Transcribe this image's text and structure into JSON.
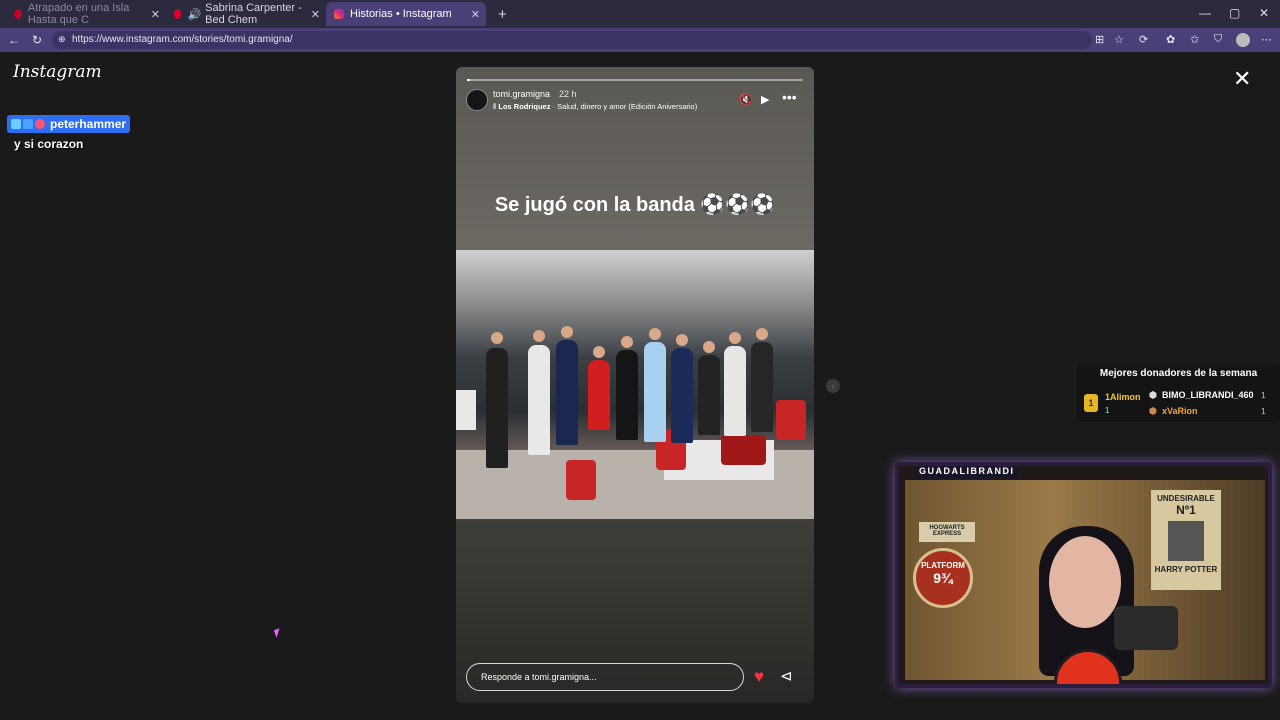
{
  "browser": {
    "tabs": [
      {
        "label": "Atrapado en una Isla Hasta que C",
        "active": false
      },
      {
        "label": "Sabrina Carpenter - Bed Chem",
        "active": false
      },
      {
        "label": "Historias • Instagram",
        "active": true
      }
    ],
    "new_tab": "+",
    "url": "https://www.instagram.com/stories/tomi.gramigna/",
    "window_controls": {
      "minimize": "—",
      "maximize": "▢",
      "close": "✕"
    }
  },
  "instagram": {
    "logo": "Instagram",
    "close": "✕"
  },
  "chat": {
    "username": "peterhammer",
    "message": "y si corazon"
  },
  "story": {
    "username": "tomi.gramigna",
    "time": "22 h",
    "song_artist": "Los Rodriquez",
    "song_title": " · Salud, dinero y amor (Edición Aniversario)",
    "caption": "Se jugó con la banda ⚽⚽⚽",
    "reply_placeholder": "Responde a tomi.gramigna...",
    "progress": 0.01
  },
  "donors": {
    "title": "Mejores donadores de la semana",
    "entries": [
      {
        "rank": "1",
        "name": "1Alimon",
        "count": "1"
      },
      {
        "rank": "2",
        "name": "BIMO_LIBRANDI_460",
        "count": "1"
      },
      {
        "rank": "3",
        "name": "xVaRion",
        "count": "1"
      }
    ]
  },
  "webcam": {
    "label": "GUADALIBRANDI",
    "poster_title": "UNDESIRABLE",
    "poster_no": "Nº1",
    "poster_name": "HARRY POTTER",
    "hogwarts": "HOGWARTS EXPRESS",
    "platform": "PLATFORM",
    "platform_no": "9¾"
  },
  "colors": {
    "tabbar": "#2c2a3f",
    "addressbar": "#4b3f78",
    "page_bg": "#1a1a1a",
    "chat_badge": "#2e6ef2",
    "heart": "#ff3040",
    "donor_gold": "#e7b826"
  }
}
